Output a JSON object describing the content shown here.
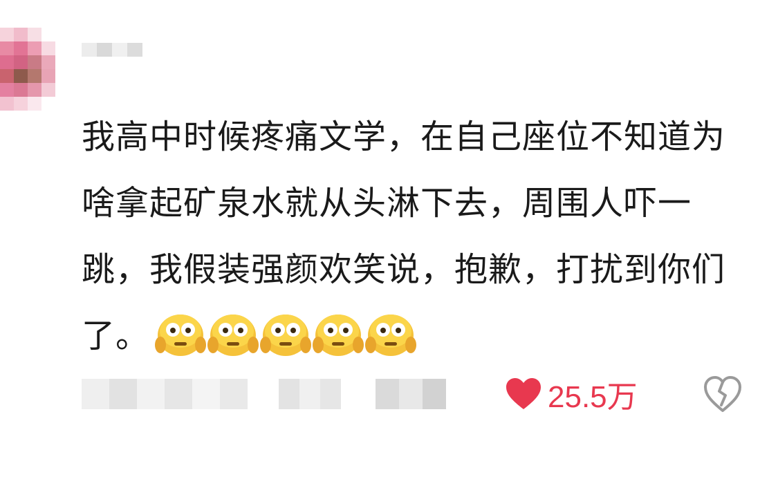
{
  "comment": {
    "text": "我高中时候疼痛文学，在自己座位不知道为啥拿起矿泉水就从头淋下去，周围人吓一跳，我假装强颜欢笑说，抱歉，打扰到你们了。",
    "emojis": [
      "pleading-face-emoji",
      "pleading-face-emoji",
      "pleading-face-emoji",
      "pleading-face-emoji",
      "pleading-face-emoji"
    ],
    "like_count": "25.5万",
    "colors": {
      "like": "#e8384f",
      "text": "#1a1a1a",
      "icon_gray": "#9a9a9a"
    },
    "icons": {
      "like": "heart-icon",
      "dislike": "broken-heart-icon"
    }
  }
}
